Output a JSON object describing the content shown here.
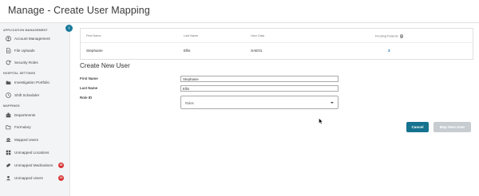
{
  "header": {
    "title": "Manage - Create User Mapping"
  },
  "sidebar": {
    "sections": [
      {
        "label": "APPLICATION MANAGEMENT"
      },
      {
        "label": "HOSPITAL SETTINGS"
      },
      {
        "label": "MAPPINGS"
      }
    ],
    "items": [
      {
        "label": "Account Management",
        "icon": "user-circle-icon"
      },
      {
        "label": "File Uploads",
        "icon": "file-icon"
      },
      {
        "label": "Security Roles",
        "icon": "refresh-icon"
      },
      {
        "label": "Investigation Portfolio",
        "icon": "folder-icon"
      },
      {
        "label": "Shift Scheduler",
        "icon": "clock-icon"
      },
      {
        "label": "Departments",
        "icon": "building-icon"
      },
      {
        "label": "Formulary",
        "icon": "folder-open-icon"
      },
      {
        "label": "Mapped Users",
        "icon": "users-icon"
      },
      {
        "label": "Unmapped Locations",
        "icon": "grid-icon"
      },
      {
        "label": "Unmapped Medications",
        "icon": "pill-icon",
        "badge": "40"
      },
      {
        "label": "Unmapped Users",
        "icon": "person-icon",
        "badge": "13"
      }
    ]
  },
  "user_table": {
    "headers": [
      "First Name",
      "Last Name",
      "User Data",
      "Pending Patients"
    ],
    "row": {
      "first_name": "Stephanie",
      "last_name": "Ellis",
      "user_data": "SAE01",
      "pending_patients": "3"
    }
  },
  "form": {
    "heading": "Create New User",
    "first_name_label": "First Name",
    "first_name_value": "Stephanie",
    "last_name_label": "Last Name",
    "last_name_value": "Ellis",
    "role_label": "Role ID",
    "role_value": "Roles"
  },
  "buttons": {
    "cancel": "Cancel",
    "map_new_user": "Map New User"
  },
  "colors": {
    "accent": "#15738f",
    "badge": "#d63333",
    "disabled": "#c7ccd1",
    "link": "#1a6fb5"
  }
}
